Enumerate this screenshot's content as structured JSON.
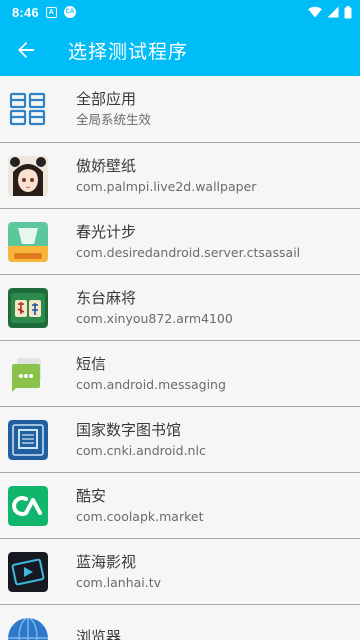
{
  "status_bar": {
    "time": "8:46",
    "a_label": "A",
    "ca_label": "CA"
  },
  "app_bar": {
    "title": "选择测试程序"
  },
  "apps": [
    {
      "name": "全部应用",
      "package": "全局系统生效",
      "icon": "grid-icon"
    },
    {
      "name": "傲娇壁纸",
      "package": "com.palmpi.live2d.wallpaper",
      "icon": "anime-girl-icon"
    },
    {
      "name": "春光计步",
      "package": "com.desiredandroid.server.ctsassail",
      "icon": "step-counter-icon"
    },
    {
      "name": "东台麻将",
      "package": "com.xinyou872.arm4100",
      "icon": "mahjong-icon"
    },
    {
      "name": "短信",
      "package": "com.android.messaging",
      "icon": "messaging-icon"
    },
    {
      "name": "国家数字图书馆",
      "package": "com.cnki.android.nlc",
      "icon": "library-icon"
    },
    {
      "name": "酷安",
      "package": "com.coolapk.market",
      "icon": "coolapk-icon"
    },
    {
      "name": "蓝海影视",
      "package": "com.lanhai.tv",
      "icon": "tv-icon"
    },
    {
      "name": "浏览器",
      "package": "",
      "icon": "browser-icon"
    }
  ],
  "colors": {
    "accent": "#00bcf7",
    "divider": "#a8a8a8"
  }
}
